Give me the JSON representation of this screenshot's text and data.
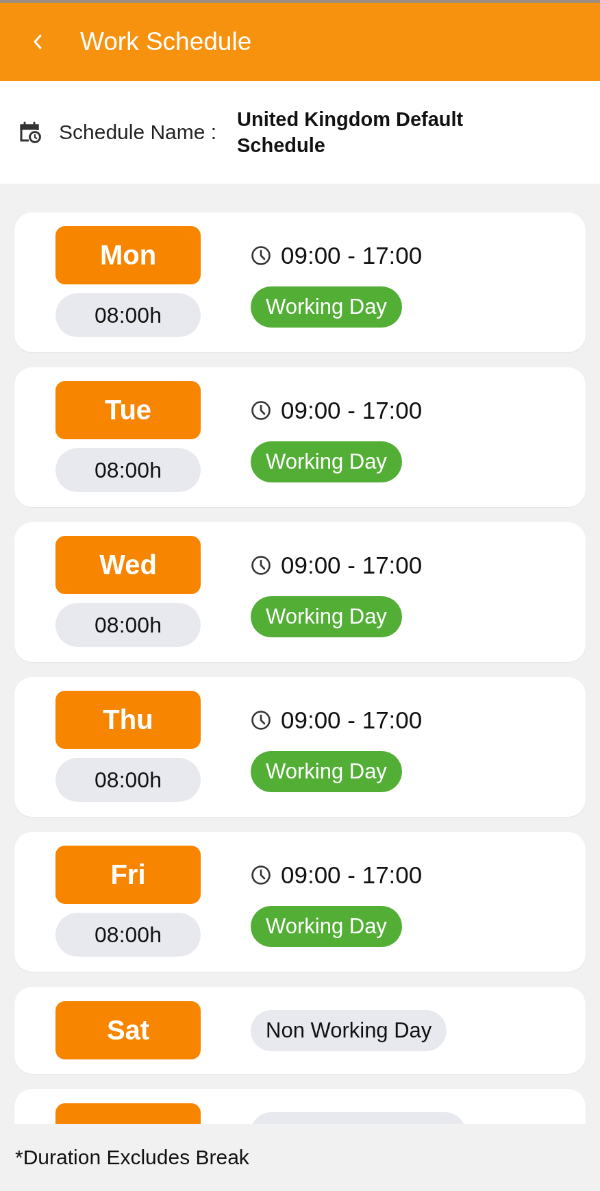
{
  "header": {
    "title": "Work Schedule"
  },
  "schedule": {
    "label": "Schedule Name :",
    "value": "United Kingdom Default Schedule"
  },
  "days": [
    {
      "kind": "working",
      "day": "Mon",
      "hours": "08:00h",
      "time": "09:00 - 17:00",
      "status": "Working Day"
    },
    {
      "kind": "working",
      "day": "Tue",
      "hours": "08:00h",
      "time": "09:00 - 17:00",
      "status": "Working Day"
    },
    {
      "kind": "working",
      "day": "Wed",
      "hours": "08:00h",
      "time": "09:00 - 17:00",
      "status": "Working Day"
    },
    {
      "kind": "working",
      "day": "Thu",
      "hours": "08:00h",
      "time": "09:00 - 17:00",
      "status": "Working Day"
    },
    {
      "kind": "working",
      "day": "Fri",
      "hours": "08:00h",
      "time": "09:00 - 17:00",
      "status": "Working Day"
    },
    {
      "kind": "non_working",
      "day": "Sat",
      "status": "Non Working Day"
    },
    {
      "kind": "non_working"
    }
  ],
  "footer": "*Duration Excludes Break"
}
